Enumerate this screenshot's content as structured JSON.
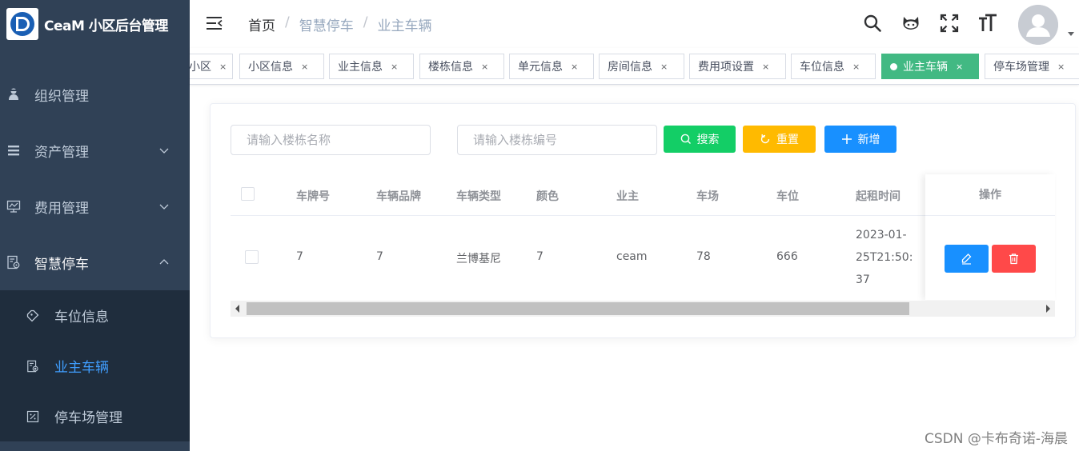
{
  "app": {
    "title": "CeaM 小区后台管理"
  },
  "sidebar": {
    "items": [
      {
        "label": "组织管理",
        "icon": "people-icon",
        "expandable": false
      },
      {
        "label": "资产管理",
        "icon": "list-icon",
        "expandable": true
      },
      {
        "label": "费用管理",
        "icon": "monitor-icon",
        "expandable": true
      },
      {
        "label": "智慧停车",
        "icon": "parking-icon",
        "expandable": true,
        "open": true
      }
    ],
    "subitems": [
      {
        "label": "车位信息",
        "icon": "tag-icon"
      },
      {
        "label": "业主车辆",
        "icon": "parking-icon",
        "active": true
      },
      {
        "label": "停车场管理",
        "icon": "percent-icon"
      }
    ]
  },
  "navbar": {
    "breadcrumb": [
      "首页",
      "智慧停车",
      "业主车辆"
    ],
    "icons": [
      "search-icon",
      "github-icon",
      "fullscreen-icon",
      "font-size-icon"
    ]
  },
  "tags": [
    {
      "label": "小区",
      "active": false
    },
    {
      "label": "小区信息",
      "active": false
    },
    {
      "label": "业主信息",
      "active": false
    },
    {
      "label": "楼栋信息",
      "active": false
    },
    {
      "label": "单元信息",
      "active": false
    },
    {
      "label": "房间信息",
      "active": false
    },
    {
      "label": "费用项设置",
      "active": false
    },
    {
      "label": "车位信息",
      "active": false
    },
    {
      "label": "业主车辆",
      "active": true
    },
    {
      "label": "停车场管理",
      "active": false
    }
  ],
  "tag_close": "×",
  "search": {
    "building_name_placeholder": "请输入楼栋名称",
    "building_code_placeholder": "请输入楼栋编号",
    "search_label": "搜索",
    "reset_label": "重置",
    "add_label": "新增"
  },
  "table": {
    "columns": [
      "车牌号",
      "车辆品牌",
      "车辆类型",
      "颜色",
      "业主",
      "车场",
      "车位",
      "起租时间"
    ],
    "actions_header": "操作",
    "rows": [
      {
        "plate": "7",
        "brand": "7",
        "type": "兰博基尼",
        "color": "7",
        "owner": "ceam",
        "lot": "78",
        "space": "666",
        "start_time": "2023-01-25T21:50:37"
      }
    ]
  },
  "watermark": "CSDN @卡布奇诺-海晨",
  "colors": {
    "sidebar_bg": "#304156",
    "submenu_bg": "#1f2d3d",
    "active_tag": "#42b983",
    "primary": "#1890ff",
    "success": "#13ce66",
    "warning": "#ffba00",
    "danger": "#ff4949"
  }
}
